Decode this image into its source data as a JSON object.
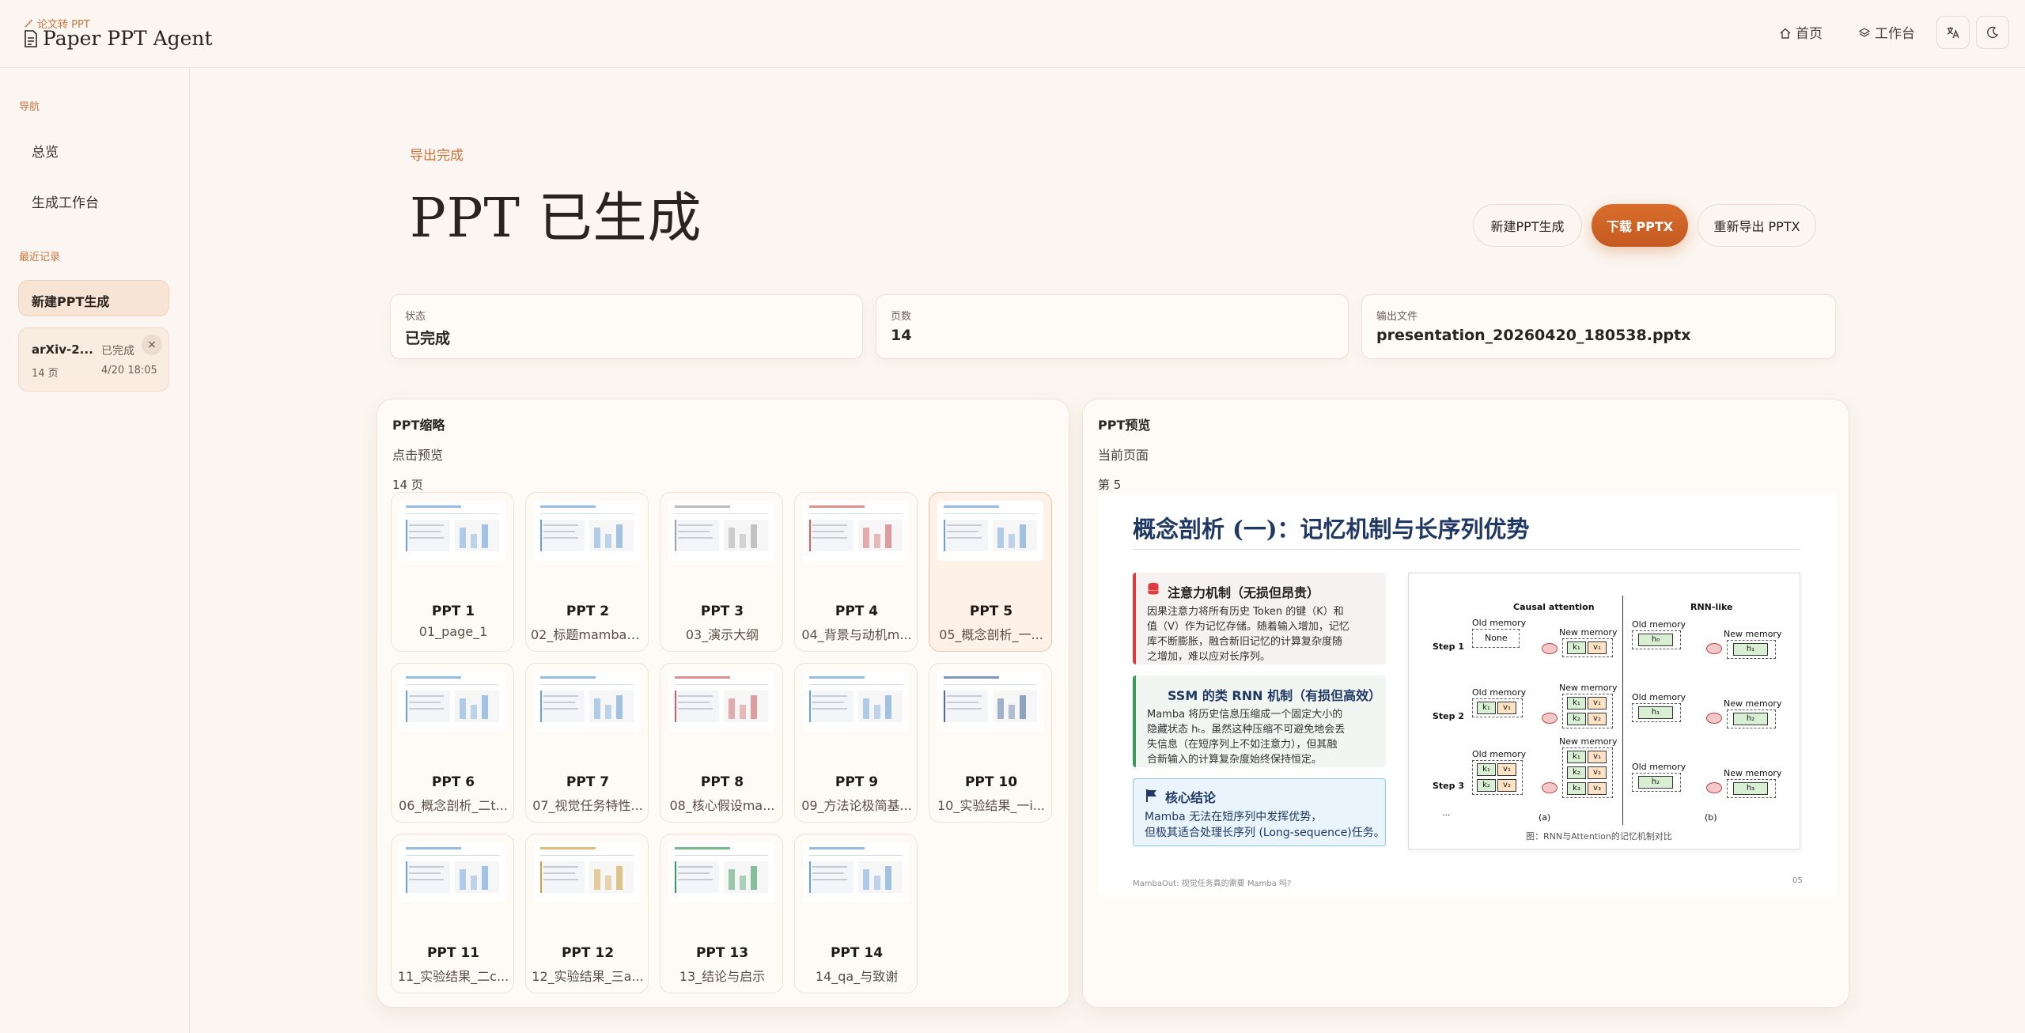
{
  "header": {
    "brand_sub": "论文转 PPT",
    "brand_title": "Paper PPT Agent",
    "nav": [
      {
        "label": "首页",
        "icon": "home-icon"
      },
      {
        "label": "工作台",
        "icon": "layers-icon"
      }
    ],
    "icons": [
      "translate-icon",
      "moon-icon"
    ]
  },
  "sidebar": {
    "nav_section": "导航",
    "nav_items": [
      "总览",
      "生成工作台"
    ],
    "recent_section": "最近记录",
    "active_item": "新建PPT生成",
    "recent": [
      {
        "title": "arXiv-2...",
        "status": "已完成",
        "pages": "14 页",
        "time": "4/20 18:05",
        "close": "×"
      }
    ]
  },
  "main": {
    "eyebrow": "导出完成",
    "title": "PPT 已生成",
    "buttons": {
      "new": "新建PPT生成",
      "download": "下载 PPTX",
      "reexport": "重新导出 PPTX"
    },
    "stats": [
      {
        "label": "状态",
        "value": "已完成"
      },
      {
        "label": "页数",
        "value": "14"
      },
      {
        "label": "输出文件",
        "value": "presentation_20260420_180538.pptx"
      }
    ]
  },
  "thumbs_panel": {
    "title": "PPT缩略",
    "subtitle": "点击预览",
    "count": "14 页",
    "items": [
      {
        "name": "PPT 1",
        "file": "01_page_1"
      },
      {
        "name": "PPT 2",
        "file": "02_标题mambao..."
      },
      {
        "name": "PPT 3",
        "file": "03_演示大纲"
      },
      {
        "name": "PPT 4",
        "file": "04_背景与动机m..."
      },
      {
        "name": "PPT 5",
        "file": "05_概念剖析_一..."
      },
      {
        "name": "PPT 6",
        "file": "06_概念剖析_二t..."
      },
      {
        "name": "PPT 7",
        "file": "07_视觉任务特性..."
      },
      {
        "name": "PPT 8",
        "file": "08_核心假设ma..."
      },
      {
        "name": "PPT 9",
        "file": "09_方法论极简基..."
      },
      {
        "name": "PPT 10",
        "file": "10_实验结果_一i..."
      },
      {
        "name": "PPT 11",
        "file": "11_实验结果_二c..."
      },
      {
        "name": "PPT 12",
        "file": "12_实验结果_三a..."
      },
      {
        "name": "PPT 13",
        "file": "13_结论与启示"
      },
      {
        "name": "PPT 14",
        "file": "14_qa_与致谢"
      }
    ]
  },
  "preview_panel": {
    "title": "PPT预览",
    "subtitle": "当前页面",
    "page": "第 5",
    "slide": {
      "title": "概念剖析 (一)：记忆机制与长序列优势",
      "box1": {
        "heading": "注意力机制（无损但昂贵）",
        "lines": [
          "因果注意力将所有历史 Token 的键（K）和",
          "值（V）作为记忆存储。随着输入增加，记忆",
          "库不断膨胀，融合新旧记忆的计算复杂度随",
          "之增加，难以应对长序列。"
        ]
      },
      "box2": {
        "heading": "SSM 的类 RNN 机制（有损但高效）",
        "lines": [
          "Mamba 将历史信息压缩成一个固定大小的",
          "隐藏状态 hₜ。虽然这种压缩不可避免地会丢",
          "失信息（在短序列上不如注意力），但其融",
          "合新输入的计算复杂度始终保持恒定。"
        ]
      },
      "box3": {
        "heading": "核心结论",
        "lines": [
          "Mamba 无法在短序列中发挥优势，",
          "但极其适合处理长序列 (Long-sequence)任务。"
        ]
      },
      "diagram": {
        "col_a": "Causal attention",
        "col_b": "RNN-like",
        "steps": [
          "Step 1",
          "Step 2",
          "Step 3"
        ],
        "old": "Old memory",
        "new": "New memory",
        "none": "None",
        "sub_a": "(a)",
        "sub_b": "(b)",
        "ellipsis": "...",
        "caption": "图：RNN与Attention的记忆机制对比"
      },
      "footer": "MambaOut: 视觉任务真的需要 Mamba 吗?",
      "number": "05"
    }
  }
}
